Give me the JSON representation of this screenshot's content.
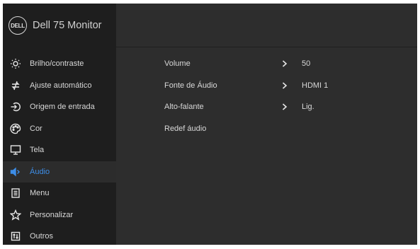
{
  "header": {
    "logo_text": "DELL",
    "title": "Dell 75 Monitor"
  },
  "sidebar": {
    "items": [
      {
        "label": "Brilho/contraste",
        "icon": "brightness-icon"
      },
      {
        "label": "Ajuste automático",
        "icon": "auto-adjust-icon"
      },
      {
        "label": "Origem de entrada",
        "icon": "input-source-icon"
      },
      {
        "label": "Cor",
        "icon": "color-icon"
      },
      {
        "label": "Tela",
        "icon": "display-icon"
      },
      {
        "label": "Áudio",
        "icon": "speaker-icon",
        "active": true
      },
      {
        "label": "Menu",
        "icon": "menu-icon"
      },
      {
        "label": "Personalizar",
        "icon": "star-icon"
      },
      {
        "label": "Outros",
        "icon": "others-icon"
      }
    ]
  },
  "audio": {
    "rows": [
      {
        "label": "Volume",
        "value": "50"
      },
      {
        "label": "Fonte de Áudio",
        "value": "HDMI 1"
      },
      {
        "label": "Alto-falante",
        "value": "Lig."
      },
      {
        "label": "Redef áudio",
        "value": ""
      }
    ]
  },
  "colors": {
    "sidebar_bg": "#1e1e1e",
    "main_bg": "#2d2d2d",
    "accent": "#3d8ee8",
    "text": "#d8d8d8"
  }
}
